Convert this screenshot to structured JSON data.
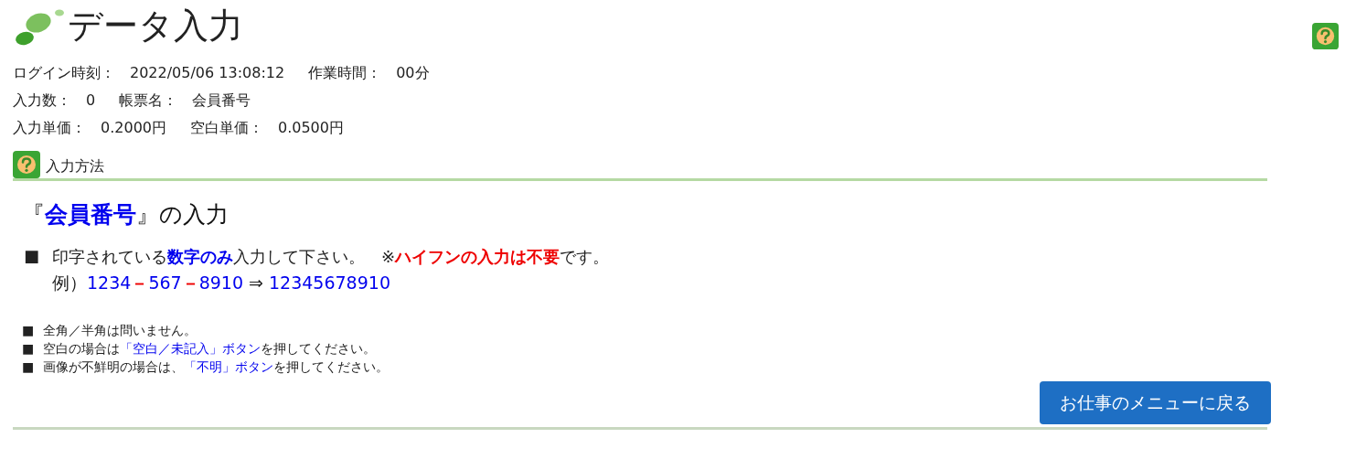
{
  "header": {
    "title": "データ入力"
  },
  "info_rows": [
    [
      {
        "label": "ログイン時刻：",
        "value": "2022/05/06 13:08:12"
      },
      {
        "label": "作業時間：",
        "value": "00分"
      }
    ],
    [
      {
        "label": "入力数：",
        "value": "0"
      },
      {
        "label": "帳票名：",
        "value": "会員番号"
      }
    ],
    [
      {
        "label": "入力単価：",
        "value": "0.2000円"
      },
      {
        "label": "空白単価：",
        "value": "0.0500円"
      }
    ]
  ],
  "section": {
    "title": "入力方法"
  },
  "heading": [
    {
      "text": "『",
      "kind": "plain"
    },
    {
      "text": "会員番号",
      "kind": "blue_bold"
    },
    {
      "text": "』の入力",
      "kind": "plain"
    }
  ],
  "main_bullet": {
    "mark": "■",
    "line": [
      {
        "text": "印字されている",
        "kind": "plain"
      },
      {
        "text": "数字のみ",
        "kind": "blue_bold"
      },
      {
        "text": "入力して下さい。　※",
        "kind": "plain"
      },
      {
        "text": "ハイフンの入力は不要",
        "kind": "red_bold"
      },
      {
        "text": "です。",
        "kind": "plain"
      }
    ],
    "example": [
      {
        "text": "例）",
        "kind": "plain"
      },
      {
        "text": "1234",
        "kind": "blue"
      },
      {
        "text": "－",
        "kind": "red_bold"
      },
      {
        "text": "567",
        "kind": "blue"
      },
      {
        "text": "－",
        "kind": "red_bold"
      },
      {
        "text": "8910",
        "kind": "blue"
      },
      {
        "text": " ⇒ ",
        "kind": "plain"
      },
      {
        "text": "12345678910",
        "kind": "blue"
      }
    ]
  },
  "notes": [
    {
      "mark": "■",
      "line": [
        {
          "text": "全角／半角は問いません。",
          "kind": "plain"
        }
      ]
    },
    {
      "mark": "■",
      "line": [
        {
          "text": "空白の場合は",
          "kind": "plain"
        },
        {
          "text": "「空白／未記入」ボタン",
          "kind": "blue"
        },
        {
          "text": "を押してください。",
          "kind": "plain"
        }
      ]
    },
    {
      "mark": "■",
      "line": [
        {
          "text": "画像が不鮮明の場合は、",
          "kind": "plain"
        },
        {
          "text": "「不明」ボタン",
          "kind": "blue"
        },
        {
          "text": "を押してください。",
          "kind": "plain"
        }
      ]
    }
  ],
  "back_button": {
    "label": "お仕事のメニューに戻る"
  }
}
